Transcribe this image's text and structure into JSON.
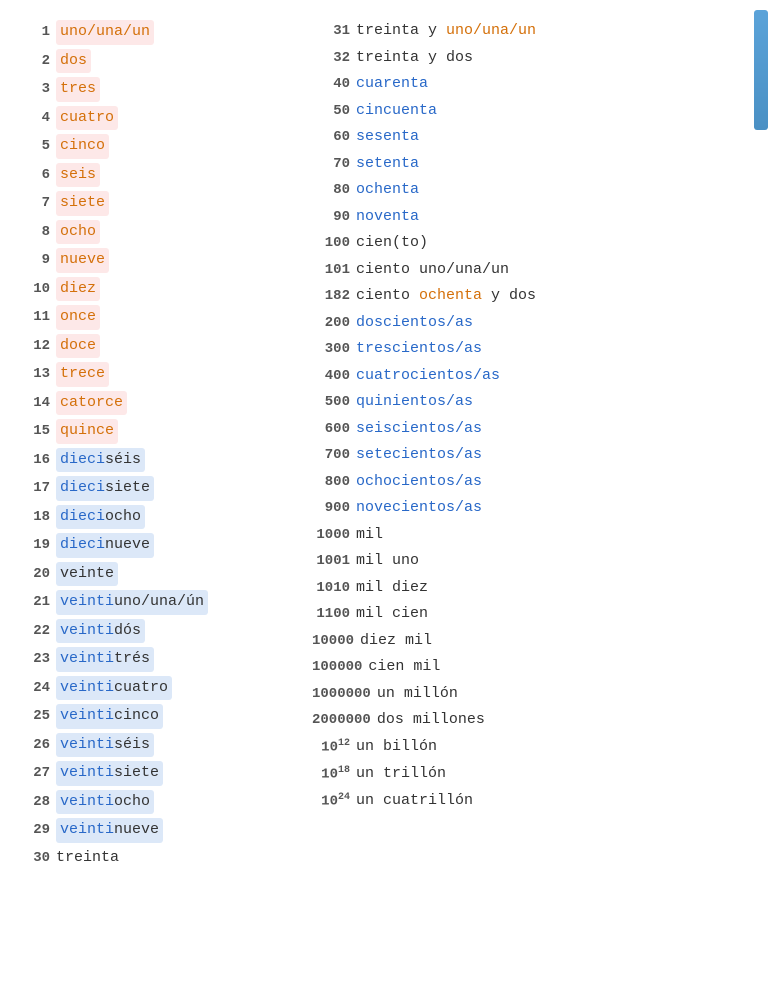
{
  "left": [
    {
      "num": "1",
      "highlight": "pink",
      "parts": [
        {
          "text": "uno/una/un",
          "color": "orange"
        }
      ]
    },
    {
      "num": "2",
      "highlight": "pink",
      "parts": [
        {
          "text": "dos",
          "color": "orange"
        }
      ]
    },
    {
      "num": "3",
      "highlight": "pink",
      "parts": [
        {
          "text": "tres",
          "color": "orange"
        }
      ]
    },
    {
      "num": "4",
      "highlight": "pink",
      "parts": [
        {
          "text": "cuatro",
          "color": "orange"
        }
      ]
    },
    {
      "num": "5",
      "highlight": "pink",
      "parts": [
        {
          "text": "cinco",
          "color": "orange"
        }
      ]
    },
    {
      "num": "6",
      "highlight": "pink",
      "parts": [
        {
          "text": "seis",
          "color": "orange"
        }
      ]
    },
    {
      "num": "7",
      "highlight": "pink",
      "parts": [
        {
          "text": "siete",
          "color": "orange"
        }
      ]
    },
    {
      "num": "8",
      "highlight": "pink",
      "parts": [
        {
          "text": "ocho",
          "color": "orange"
        }
      ]
    },
    {
      "num": "9",
      "highlight": "pink",
      "parts": [
        {
          "text": "nueve",
          "color": "orange"
        }
      ]
    },
    {
      "num": "10",
      "highlight": "pink",
      "parts": [
        {
          "text": "diez",
          "color": "orange"
        }
      ]
    },
    {
      "num": "11",
      "highlight": "pink",
      "parts": [
        {
          "text": "once",
          "color": "orange"
        }
      ]
    },
    {
      "num": "12",
      "highlight": "pink",
      "parts": [
        {
          "text": "doce",
          "color": "orange"
        }
      ]
    },
    {
      "num": "13",
      "highlight": "pink",
      "parts": [
        {
          "text": "trece",
          "color": "orange"
        }
      ]
    },
    {
      "num": "14",
      "highlight": "pink",
      "parts": [
        {
          "text": "catorce",
          "color": "orange"
        }
      ]
    },
    {
      "num": "15",
      "highlight": "pink",
      "parts": [
        {
          "text": "quince",
          "color": "orange"
        }
      ]
    },
    {
      "num": "16",
      "highlight": "blue",
      "parts": [
        {
          "text": "dieci",
          "color": "blue"
        },
        {
          "text": "séis",
          "color": "dark"
        }
      ]
    },
    {
      "num": "17",
      "highlight": "blue",
      "parts": [
        {
          "text": "dieci",
          "color": "blue"
        },
        {
          "text": "siete",
          "color": "dark"
        }
      ]
    },
    {
      "num": "18",
      "highlight": "blue",
      "parts": [
        {
          "text": "dieci",
          "color": "blue"
        },
        {
          "text": "ocho",
          "color": "dark"
        }
      ]
    },
    {
      "num": "19",
      "highlight": "blue",
      "parts": [
        {
          "text": "dieci",
          "color": "blue"
        },
        {
          "text": "nueve",
          "color": "dark"
        }
      ]
    },
    {
      "num": "20",
      "highlight": "blue",
      "parts": [
        {
          "text": "veinte",
          "color": "dark"
        }
      ]
    },
    {
      "num": "21",
      "highlight": "blue",
      "parts": [
        {
          "text": "veinti",
          "color": "blue"
        },
        {
          "text": "uno/una/ún",
          "color": "dark"
        }
      ]
    },
    {
      "num": "22",
      "highlight": "blue",
      "parts": [
        {
          "text": "veinti",
          "color": "blue"
        },
        {
          "text": "dós",
          "color": "dark"
        }
      ]
    },
    {
      "num": "23",
      "highlight": "blue",
      "parts": [
        {
          "text": "veinti",
          "color": "blue"
        },
        {
          "text": "trés",
          "color": "dark"
        }
      ]
    },
    {
      "num": "24",
      "highlight": "blue",
      "parts": [
        {
          "text": "veinti",
          "color": "blue"
        },
        {
          "text": "cuatro",
          "color": "dark"
        }
      ]
    },
    {
      "num": "25",
      "highlight": "blue",
      "parts": [
        {
          "text": "veinti",
          "color": "blue"
        },
        {
          "text": "cinco",
          "color": "dark"
        }
      ]
    },
    {
      "num": "26",
      "highlight": "blue",
      "parts": [
        {
          "text": "veinti",
          "color": "blue"
        },
        {
          "text": "séis",
          "color": "dark"
        }
      ]
    },
    {
      "num": "27",
      "highlight": "blue",
      "parts": [
        {
          "text": "veinti",
          "color": "blue"
        },
        {
          "text": "siete",
          "color": "dark"
        }
      ]
    },
    {
      "num": "28",
      "highlight": "blue",
      "parts": [
        {
          "text": "veinti",
          "color": "blue"
        },
        {
          "text": "ocho",
          "color": "dark"
        }
      ]
    },
    {
      "num": "29",
      "highlight": "blue",
      "parts": [
        {
          "text": "veinti",
          "color": "blue"
        },
        {
          "text": "nueve",
          "color": "dark"
        }
      ]
    },
    {
      "num": "30",
      "highlight": "none",
      "parts": [
        {
          "text": "treinta",
          "color": "dark"
        }
      ]
    }
  ],
  "right": [
    {
      "num": "31",
      "parts": [
        {
          "text": "treinta y ",
          "color": "dark"
        },
        {
          "text": "uno/una/un",
          "color": "orange"
        }
      ]
    },
    {
      "num": "32",
      "parts": [
        {
          "text": "treinta y dos",
          "color": "dark"
        }
      ]
    },
    {
      "num": "40",
      "parts": [
        {
          "text": "cuarenta",
          "color": "blue"
        }
      ]
    },
    {
      "num": "50",
      "parts": [
        {
          "text": "cincuenta",
          "color": "blue"
        }
      ]
    },
    {
      "num": "60",
      "parts": [
        {
          "text": "sesenta",
          "color": "blue"
        }
      ]
    },
    {
      "num": "70",
      "parts": [
        {
          "text": "setenta",
          "color": "blue"
        }
      ]
    },
    {
      "num": "80",
      "parts": [
        {
          "text": "ochenta",
          "color": "blue"
        }
      ]
    },
    {
      "num": "90",
      "parts": [
        {
          "text": "noventa",
          "color": "blue"
        }
      ]
    },
    {
      "num": "100",
      "parts": [
        {
          "text": "cien(to)",
          "color": "dark"
        }
      ]
    },
    {
      "num": "101",
      "parts": [
        {
          "text": "ciento uno/una/un",
          "color": "dark"
        }
      ]
    },
    {
      "num": "182",
      "parts": [
        {
          "text": "ciento ",
          "color": "dark"
        },
        {
          "text": "ochenta",
          "color": "orange"
        },
        {
          "text": " y dos",
          "color": "dark"
        }
      ]
    },
    {
      "num": "200",
      "parts": [
        {
          "text": "doscientos/as",
          "color": "blue"
        }
      ]
    },
    {
      "num": "300",
      "parts": [
        {
          "text": "trescientos/as",
          "color": "blue"
        }
      ]
    },
    {
      "num": "400",
      "parts": [
        {
          "text": "cuatrocientos/as",
          "color": "blue"
        }
      ]
    },
    {
      "num": "500",
      "parts": [
        {
          "text": "quinientos/as",
          "color": "blue"
        }
      ]
    },
    {
      "num": "600",
      "parts": [
        {
          "text": "seiscientos/as",
          "color": "blue"
        }
      ]
    },
    {
      "num": "700",
      "parts": [
        {
          "text": "setecientos/as",
          "color": "blue"
        }
      ]
    },
    {
      "num": "800",
      "parts": [
        {
          "text": "ochocientos/as",
          "color": "blue"
        }
      ]
    },
    {
      "num": "900",
      "parts": [
        {
          "text": "novecientos/as",
          "color": "blue"
        }
      ]
    },
    {
      "num": "1000",
      "parts": [
        {
          "text": "mil",
          "color": "dark"
        }
      ]
    },
    {
      "num": "1001",
      "parts": [
        {
          "text": "mil uno",
          "color": "dark"
        }
      ]
    },
    {
      "num": "1010",
      "parts": [
        {
          "text": "mil diez",
          "color": "dark"
        }
      ]
    },
    {
      "num": "1100",
      "parts": [
        {
          "text": "mil cien",
          "color": "dark"
        }
      ]
    },
    {
      "num": "10000",
      "parts": [
        {
          "text": "diez mil",
          "color": "dark"
        }
      ]
    },
    {
      "num": "100000",
      "parts": [
        {
          "text": "cien mil",
          "color": "dark"
        }
      ]
    },
    {
      "num": "1000000",
      "parts": [
        {
          "text": "un millón",
          "color": "dark"
        }
      ]
    },
    {
      "num": "2000000",
      "parts": [
        {
          "text": "dos millones",
          "color": "dark"
        }
      ]
    },
    {
      "num": "10^12",
      "sup": "12",
      "base": "10",
      "parts": [
        {
          "text": "un billón",
          "color": "dark"
        }
      ]
    },
    {
      "num": "10^18",
      "sup": "18",
      "base": "10",
      "parts": [
        {
          "text": "un trillón",
          "color": "dark"
        }
      ]
    },
    {
      "num": "10^24",
      "sup": "24",
      "base": "10",
      "parts": [
        {
          "text": "un cuatrillón",
          "color": "dark"
        }
      ]
    }
  ],
  "colors": {
    "orange": "#d4700a",
    "blue": "#2868c8",
    "dark": "#333333",
    "pink_bg": "#fde8e8",
    "blue_bg": "#dce8f8"
  }
}
